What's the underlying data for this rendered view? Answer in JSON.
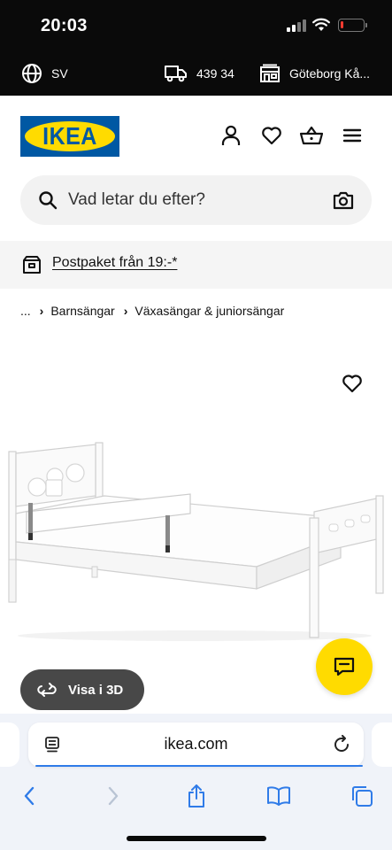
{
  "status": {
    "time": "20:03",
    "battery_level": 0.12,
    "battery_color": "#ff3b30"
  },
  "info_bar": {
    "language": "SV",
    "language_icon": "globe-icon",
    "zip": "439 34",
    "zip_icon": "truck-icon",
    "store": "Göteborg Kå...",
    "store_icon": "store-icon"
  },
  "header": {
    "logo": "IKEA",
    "icons": [
      "user-icon",
      "heart-icon",
      "basket-icon",
      "menu-icon"
    ]
  },
  "search": {
    "placeholder": "Vad letar du efter?",
    "icon": "search-icon",
    "camera_icon": "camera-icon"
  },
  "promo": {
    "text": "Postpaket från 19:-*",
    "icon": "package-icon"
  },
  "breadcrumb": {
    "items": [
      "...",
      "Barnsängar",
      "Växasängar & juniorsängar"
    ]
  },
  "product": {
    "image_alt": "white children's bed with guard rail",
    "view3d_label": "Visa i 3D",
    "view3d_icon": "rotate-3d-icon",
    "chat_icon": "chat-icon",
    "favorite_icon": "heart-icon"
  },
  "browser": {
    "url": "ikea.com",
    "nav_icons": [
      "back-icon",
      "forward-icon",
      "share-icon",
      "bookmarks-icon",
      "tabs-icon"
    ]
  },
  "colors": {
    "ikea_blue": "#0058a3",
    "ikea_yellow": "#ffdb00",
    "dark_bar": "#0a0a0a",
    "browser_blue": "#2f7be8"
  }
}
